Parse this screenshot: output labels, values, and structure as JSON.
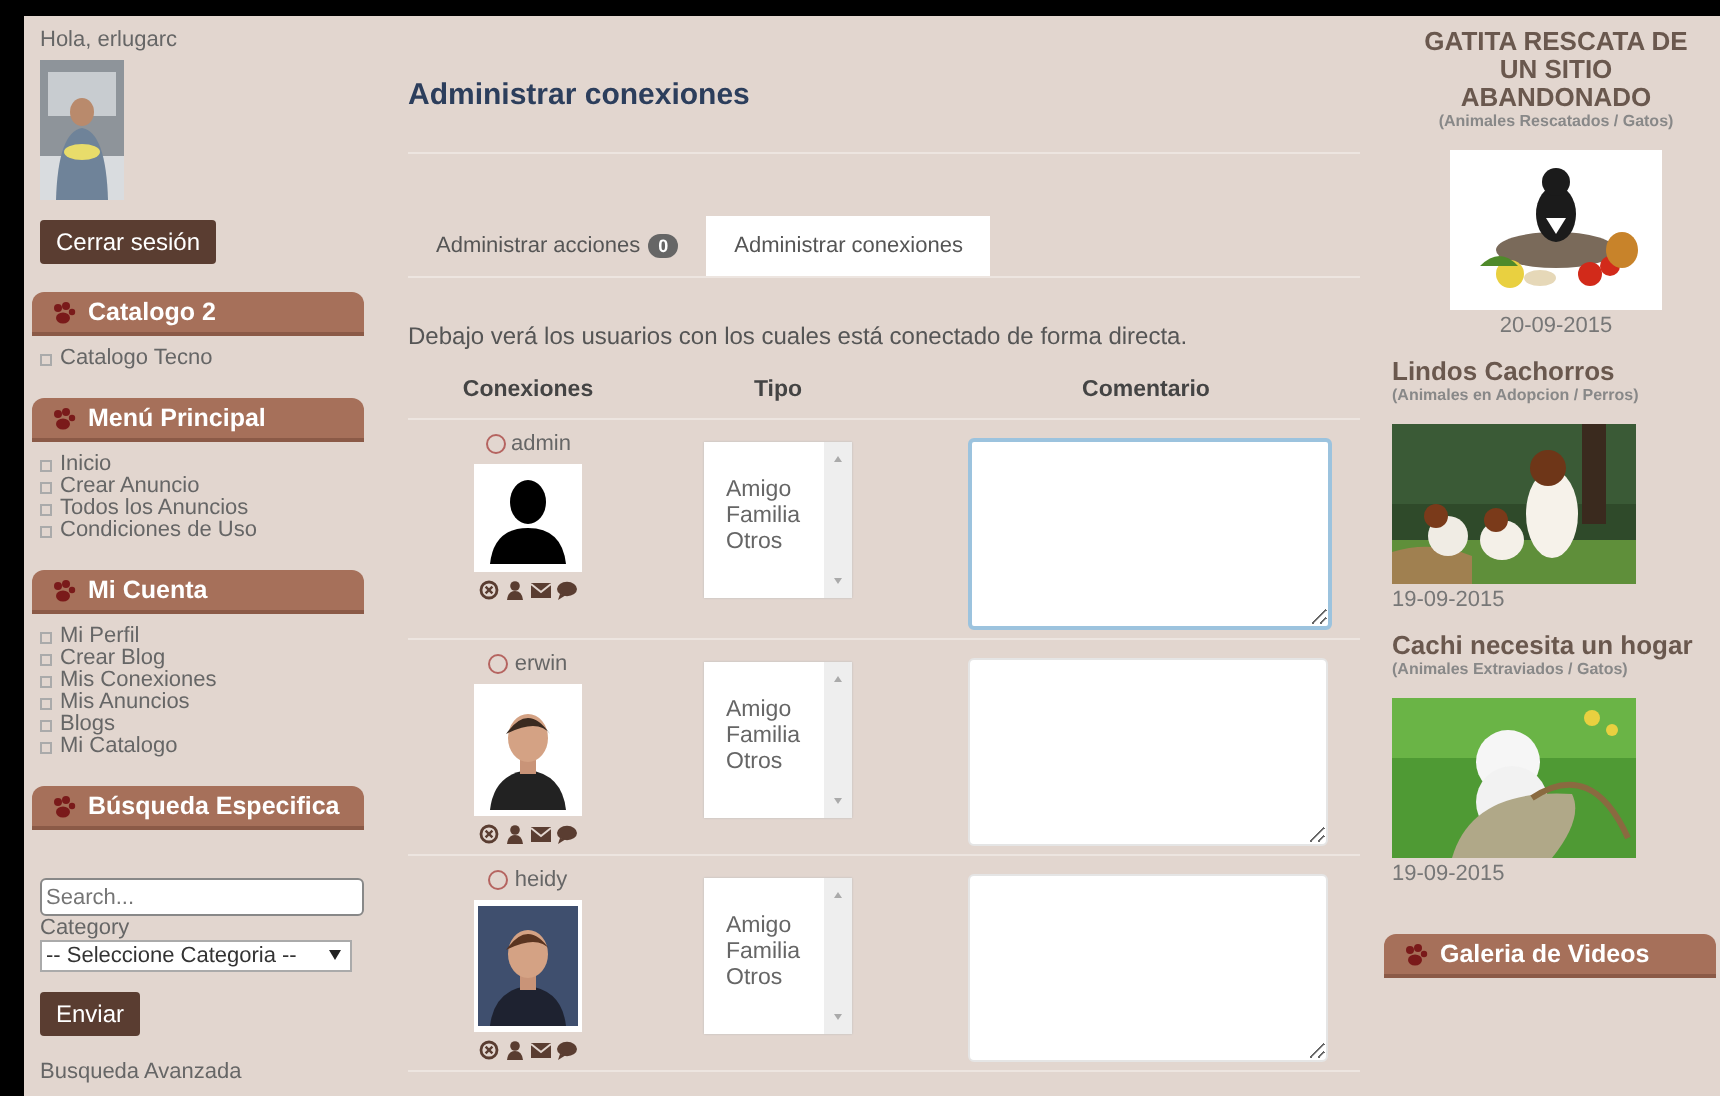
{
  "sidebar": {
    "greeting": "Hola, erlugarc",
    "logout": "Cerrar sesión",
    "sections": [
      {
        "title": "Catalogo 2",
        "items": [
          "Catalogo Tecno"
        ]
      },
      {
        "title": "Menú Principal",
        "items": [
          "Inicio",
          "Crear Anuncio",
          "Todos los Anuncios",
          "Condiciones de Uso"
        ]
      },
      {
        "title": "Mi Cuenta",
        "items": [
          "Mi Perfil",
          "Crear Blog",
          "Mis Conexiones",
          "Mis Anuncios",
          "Blogs",
          "Mi Catalogo"
        ]
      }
    ],
    "search": {
      "title": "Búsqueda Especifica",
      "placeholder": "Search...",
      "category_label": "Category",
      "category_value": "-- Seleccione Categoria --",
      "submit": "Enviar",
      "advanced": "Busqueda Avanzada"
    }
  },
  "main": {
    "heading": "Administrar conexiones",
    "tabs": [
      {
        "label": "Administrar acciones",
        "badge": "0",
        "selected": false
      },
      {
        "label": "Administrar conexiones",
        "selected": true
      }
    ],
    "description": "Debajo verá los usuarios con los cuales está conectado de forma directa.",
    "columns": [
      "Conexiones",
      "Tipo",
      "Comentario"
    ],
    "rows": [
      {
        "user": "admin",
        "kind": "silhouette",
        "options": [
          "Amigo",
          "Familia",
          "Otros"
        ],
        "focused": true
      },
      {
        "user": "erwin",
        "kind": "picture",
        "options": [
          "Amigo",
          "Familia",
          "Otros"
        ],
        "focused": false
      },
      {
        "user": "heidy",
        "kind": "picture",
        "options": [
          "Amigo",
          "Familia",
          "Otros"
        ],
        "focused": false
      }
    ]
  },
  "right": {
    "posts": [
      {
        "kind": "featured",
        "title": "GATITA RESCATA DE UN SITIO ABANDONADO",
        "category": "(Animales Rescatados / Gatos)",
        "date": "20-09-2015"
      },
      {
        "kind": "regular",
        "title": "Lindos Cachorros",
        "category": "(Animales en Adopcion / Perros)",
        "date": "19-09-2015"
      },
      {
        "kind": "regular",
        "title": "Cachi necesita un hogar",
        "category": "(Animales Extraviados / Gatos)",
        "date": "19-09-2015"
      }
    ],
    "gallery_title": "Galeria de Videos"
  }
}
